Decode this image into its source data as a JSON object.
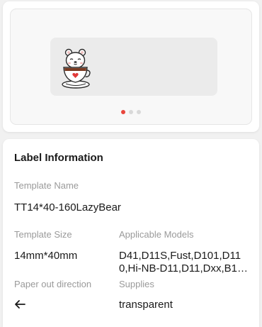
{
  "preview": {
    "image_icon": "bear-in-teacup-icon",
    "carousel": {
      "count": 3,
      "active_index": 0,
      "active_color": "#e8453c"
    }
  },
  "info": {
    "title": "Label Information",
    "template_name_label": "Template Name",
    "template_name_value": "TT14*40-160LazyBear",
    "template_size_label": "Template Size",
    "template_size_value": "14mm*40mm",
    "models_label": "Applicable Models",
    "models_value": "D41,D11S,Fust,D101,D110,Hi-NB-D11,D11,Dxx,B16,...",
    "paper_out_label": "Paper out direction",
    "paper_out_icon": "arrow-left-icon",
    "supplies_label": "Supplies",
    "supplies_value": "transparent"
  }
}
